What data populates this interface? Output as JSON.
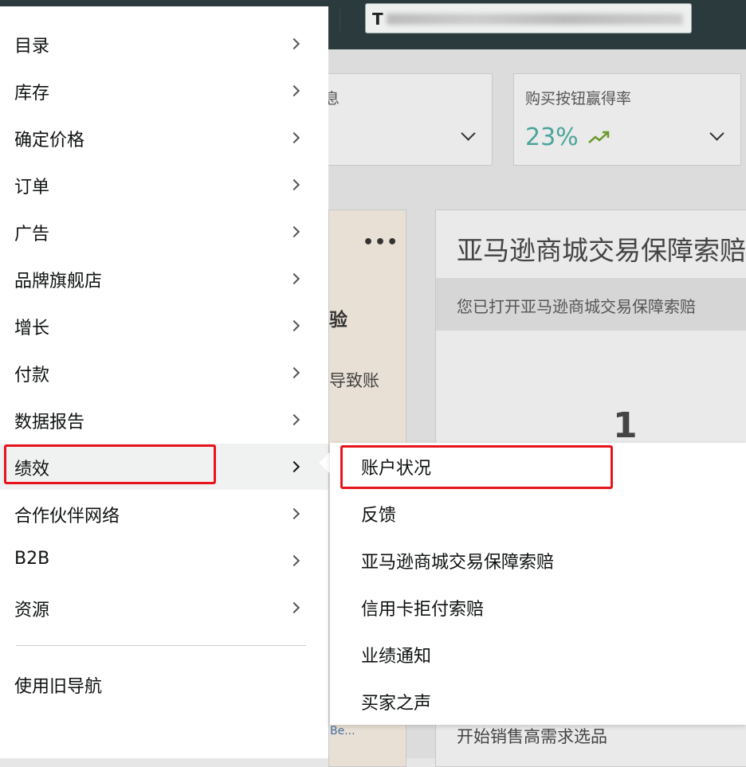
{
  "header": {
    "search_prefix": "T"
  },
  "background": {
    "card1_label_fragment": "息",
    "card2_label": "购买按钮赢得率",
    "card2_value": "23%",
    "trend_icon": "trending-up-icon",
    "more_icon": "ellipsis-icon",
    "midcard_text1": "验",
    "midcard_text2": "导致账",
    "claim_title": "亚马逊商城交易保障索赔",
    "claim_subtitle": "您已打开亚马逊商城交易保障索赔",
    "claim_count": "1",
    "claim_bottom": "开始销售高需求选品",
    "truncated_link": "Be..."
  },
  "menu": {
    "items": [
      {
        "label": "目录"
      },
      {
        "label": "库存"
      },
      {
        "label": "确定价格"
      },
      {
        "label": "订单"
      },
      {
        "label": "广告"
      },
      {
        "label": "品牌旗舰店"
      },
      {
        "label": "增长"
      },
      {
        "label": "付款"
      },
      {
        "label": "数据报告"
      },
      {
        "label": "绩效"
      },
      {
        "label": "合作伙伴网络"
      },
      {
        "label": "B2B"
      },
      {
        "label": "资源"
      }
    ],
    "active_index": 9,
    "old_nav_label": "使用旧导航"
  },
  "submenu": {
    "items": [
      {
        "label": "账户状况"
      },
      {
        "label": "反馈"
      },
      {
        "label": "亚马逊商城交易保障索赔"
      },
      {
        "label": "信用卡拒付索赔"
      },
      {
        "label": "业绩通知"
      },
      {
        "label": "买家之声"
      }
    ]
  },
  "colors": {
    "highlight": "#e8141c",
    "accent_teal": "#4aa59c",
    "topbar": "#2b3a3c"
  }
}
